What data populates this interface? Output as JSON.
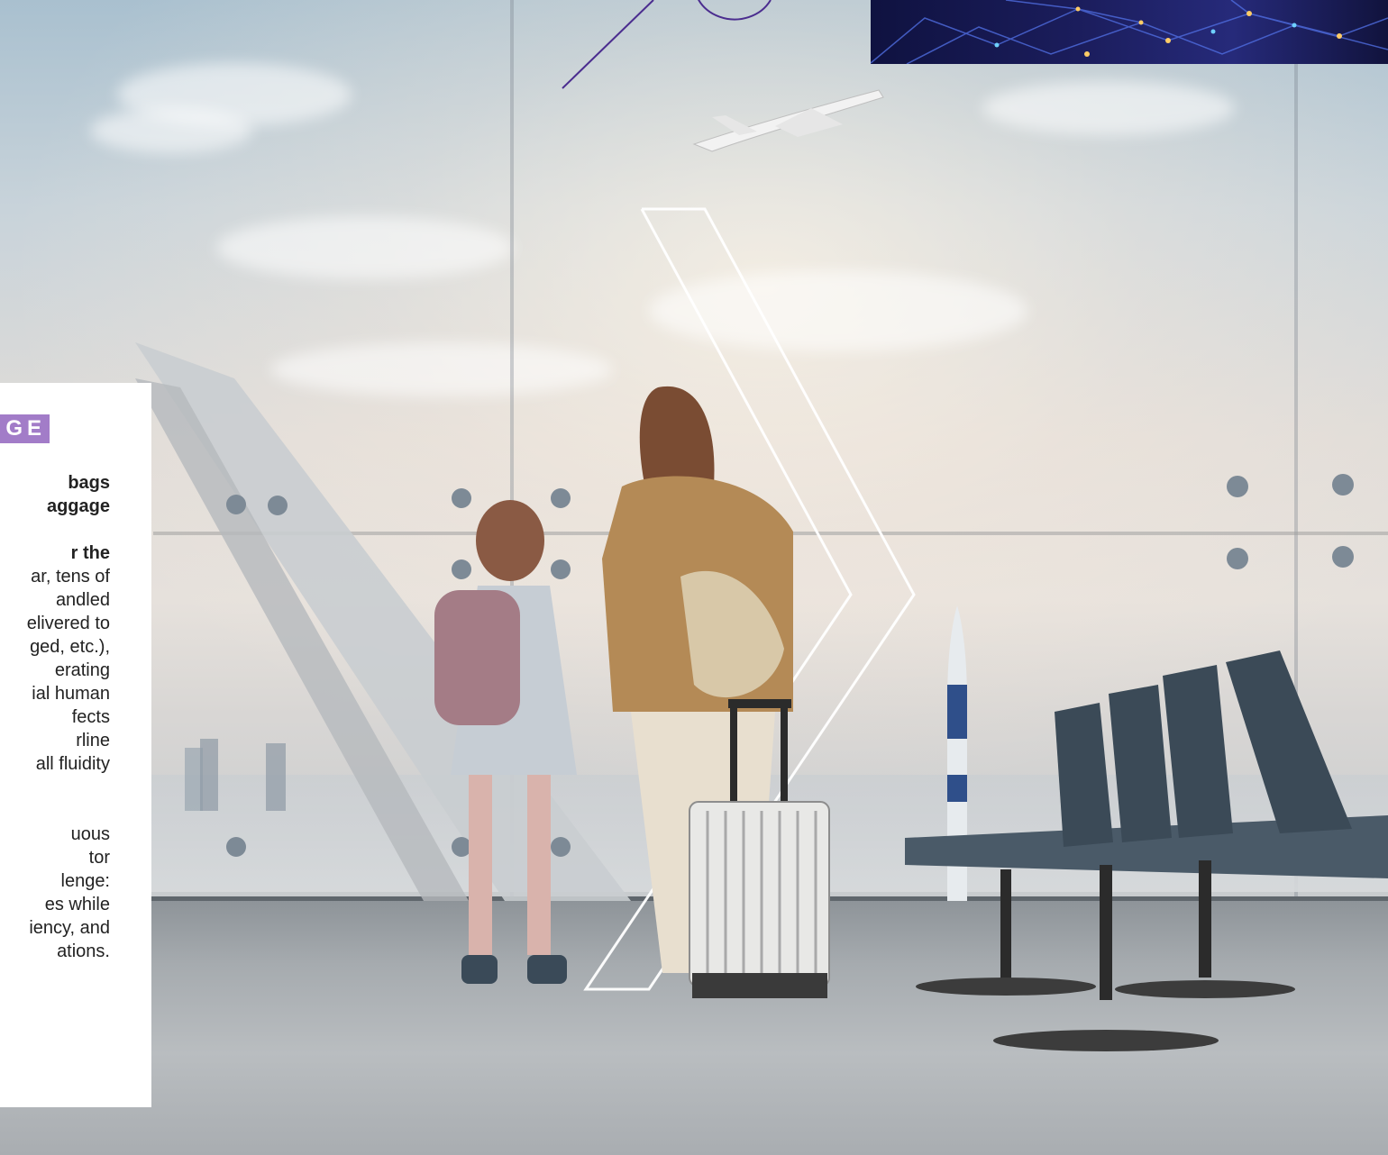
{
  "panel": {
    "badge": "GE",
    "lines": [
      {
        "text": "bags",
        "bold": true
      },
      {
        "text": "aggage",
        "bold": true
      },
      {
        "text": "",
        "bold": false
      },
      {
        "text": "r the",
        "bold": true
      },
      {
        "text": "ar, tens of",
        "bold": false
      },
      {
        "text": "andled",
        "bold": false
      },
      {
        "text": "elivered to",
        "bold": false
      },
      {
        "text": "ged, etc.),",
        "bold": false
      },
      {
        "text": "erating",
        "bold": false
      },
      {
        "text": "ial human",
        "bold": false
      },
      {
        "text": "fects",
        "bold": false
      },
      {
        "text": "rline",
        "bold": false
      },
      {
        "text": "all fluidity",
        "bold": false
      },
      {
        "text": "",
        "bold": false
      },
      {
        "text": "",
        "bold": false
      },
      {
        "text": "uous",
        "bold": false
      },
      {
        "text": "tor",
        "bold": false
      },
      {
        "text": "lenge:",
        "bold": false
      },
      {
        "text": "es while",
        "bold": false
      },
      {
        "text": "iency, and",
        "bold": false
      },
      {
        "text": "ations.",
        "bold": false
      }
    ]
  },
  "colors": {
    "badge": "#a27cc8",
    "accent_line": "#4b2d8f",
    "circuit_bg": "#1b1d5c"
  }
}
